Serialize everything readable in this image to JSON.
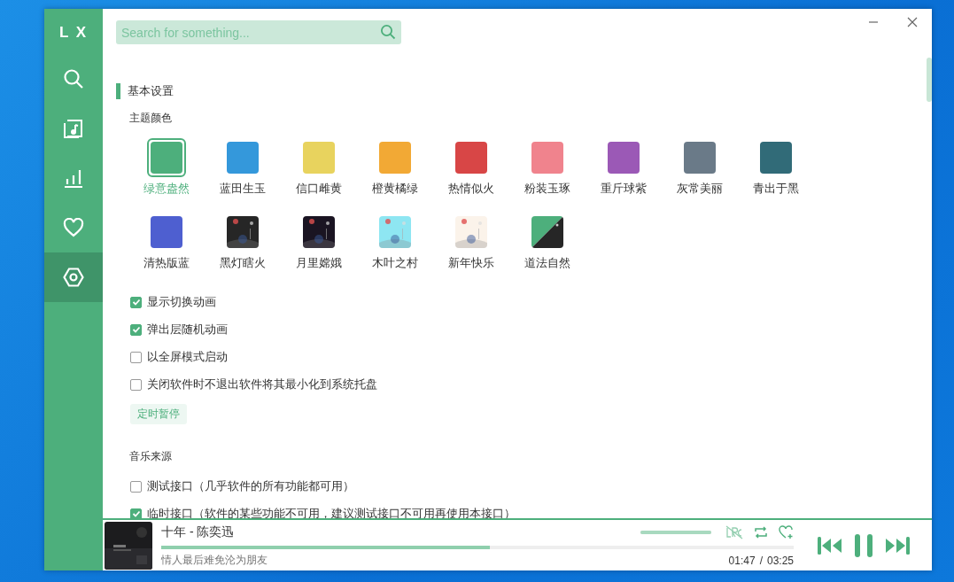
{
  "sidebar": {
    "logo": "L X",
    "items": [
      {
        "kind": "search",
        "selected": false
      },
      {
        "kind": "music",
        "selected": false
      },
      {
        "kind": "chart",
        "selected": false
      },
      {
        "kind": "heart",
        "selected": false
      },
      {
        "kind": "settings",
        "selected": true
      }
    ]
  },
  "search": {
    "placeholder": "Search for something..."
  },
  "section": {
    "title": "基本设置",
    "theme_label": "主题颜色",
    "themes": [
      {
        "name": "绿意盎然",
        "kind": "color",
        "color": "#4daf7c",
        "selected": true
      },
      {
        "name": "蓝田生玉",
        "kind": "color",
        "color": "#3498db",
        "selected": false
      },
      {
        "name": "信口雌黄",
        "kind": "color",
        "color": "#e8d35e",
        "selected": false
      },
      {
        "name": "橙黄橘绿",
        "kind": "color",
        "color": "#f2a935",
        "selected": false
      },
      {
        "name": "热情似火",
        "kind": "color",
        "color": "#d84646",
        "selected": false
      },
      {
        "name": "粉装玉琢",
        "kind": "color",
        "color": "#f0838d",
        "selected": false
      },
      {
        "name": "重斤球紫",
        "kind": "color",
        "color": "#9b59b6",
        "selected": false
      },
      {
        "name": "灰常美丽",
        "kind": "color",
        "color": "#6a7a88",
        "selected": false
      },
      {
        "name": "青出于黑",
        "kind": "color",
        "color": "#316b78",
        "selected": false
      },
      {
        "name": "清热版蓝",
        "kind": "color",
        "color": "#4e5fd0",
        "selected": false
      },
      {
        "name": "黑灯瞎火",
        "kind": "picture",
        "color": "#262626",
        "selected": false
      },
      {
        "name": "月里嫦娥",
        "kind": "picture",
        "color": "#1a1422",
        "selected": false
      },
      {
        "name": "木叶之村",
        "kind": "picture",
        "color": "#8ee6f2",
        "selected": false
      },
      {
        "name": "新年快乐",
        "kind": "picture",
        "color": "#fbf3ea",
        "selected": false
      },
      {
        "name": "道法自然",
        "kind": "split",
        "color": "#4daf7c",
        "selected": false
      }
    ],
    "options": [
      {
        "label": "显示切换动画",
        "checked": true
      },
      {
        "label": "弹出层随机动画",
        "checked": true
      },
      {
        "label": "以全屏模式启动",
        "checked": false
      },
      {
        "label": "关闭软件时不退出软件将其最小化到系统托盘",
        "checked": false
      }
    ],
    "timer_button": "定时暂停",
    "source_label": "音乐来源",
    "sources": [
      {
        "label": "测试接口（几乎软件的所有功能都可用）",
        "checked": false
      },
      {
        "label": "临时接口（软件的某些功能不可用，建议测试接口不可用再使用本接口）",
        "checked": true
      }
    ]
  },
  "player": {
    "title": "十年 - 陈奕迅",
    "lyric": "情人最后难免沦为朋友",
    "progress": {
      "level": 0.52
    },
    "volume": {
      "level": 1.0
    },
    "lyrics_on": false,
    "time": "01:47",
    "separator": "/",
    "duration": "03:25",
    "playing": true
  }
}
